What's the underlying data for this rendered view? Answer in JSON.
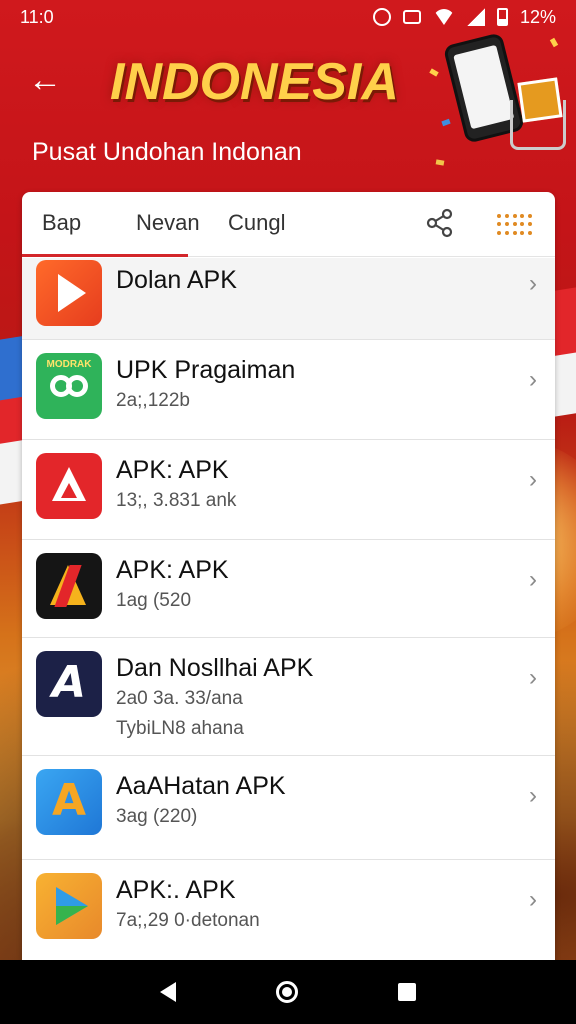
{
  "status_bar": {
    "time": "11:0",
    "battery": "12%"
  },
  "header": {
    "title": "INDONESIA",
    "subtitle": "Pusat Undohan Indonan"
  },
  "tabs": [
    {
      "label": "Bap"
    },
    {
      "label": "Nevan"
    },
    {
      "label": "Cungl"
    }
  ],
  "apps": [
    {
      "name": "Dolan APK",
      "meta1": "",
      "meta2": "",
      "icon": "play-arrow-icon"
    },
    {
      "name": "UPK Pragaiman",
      "meta1": "2a;,122b",
      "meta2": "",
      "icon": "modrak-app-icon",
      "icon_label": "MODRAK"
    },
    {
      "name": "APK: APK",
      "meta1": "13;, 3.831 ank",
      "meta2": "",
      "icon": "red-triangle-icon"
    },
    {
      "name": "APK: APK",
      "meta1": "1ag (520",
      "meta2": "",
      "icon": "a-logo-icon"
    },
    {
      "name": "Dan Nosllhai APK",
      "meta1": "2a0 3a. 33/ana",
      "meta2": "TybiLN8 ahana",
      "icon": "navy-a-icon"
    },
    {
      "name": "AaAHatan APK",
      "meta1": "3ag (220)",
      "meta2": "",
      "icon": "blue-a-icon"
    },
    {
      "name": "APK:. APK",
      "meta1": "7a;,29 0·detonan",
      "meta2": "",
      "icon": "play-store-icon"
    }
  ],
  "colors": {
    "brand_red": "#d0191d",
    "title_gold": "#ffd04a",
    "tab_indicator": "#d3262a",
    "menu_dots": "#e08a22"
  }
}
